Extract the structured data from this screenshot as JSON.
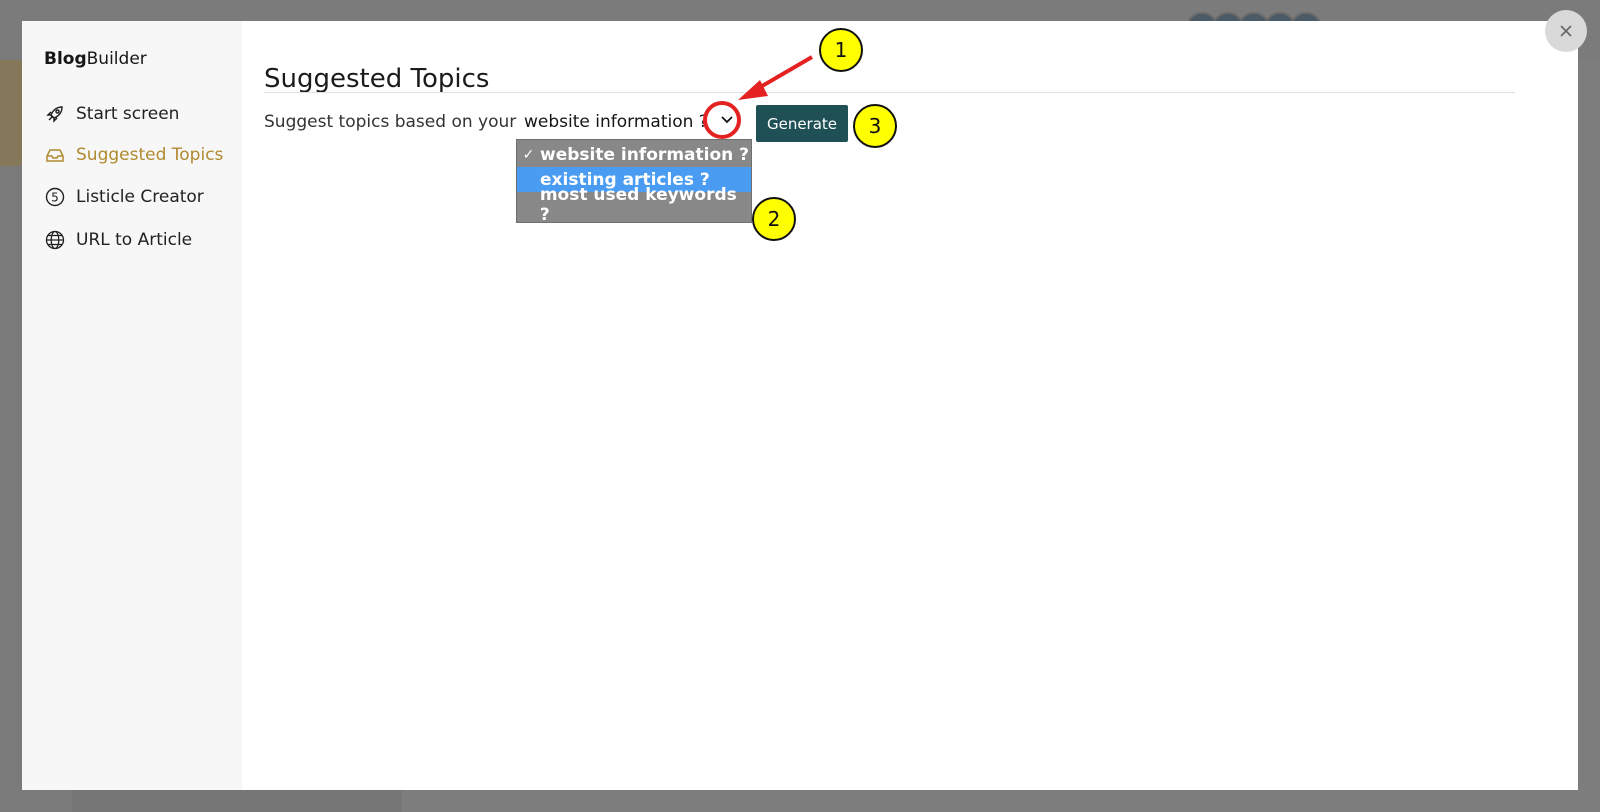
{
  "app": {
    "brand_bold": "Blog",
    "brand_rest": "Builder"
  },
  "sidebar": {
    "items": [
      {
        "label": "Start screen",
        "icon": "rocket-icon",
        "active": false
      },
      {
        "label": "Suggested Topics",
        "icon": "inbox-icon",
        "active": true
      },
      {
        "label": "Listicle Creator",
        "icon": "number-five-icon",
        "active": false
      },
      {
        "label": "URL to Article",
        "icon": "globe-icon",
        "active": false
      }
    ]
  },
  "main": {
    "title": "Suggested Topics",
    "prompt": "Suggest topics based on your",
    "select": {
      "value": "website information ?",
      "options": [
        {
          "label": "website information ?",
          "checked": true
        },
        {
          "label": "existing articles ?",
          "highlighted": true
        },
        {
          "label": "most used keywords ?"
        }
      ]
    },
    "generate_label": "Generate"
  },
  "annotations": {
    "callouts": [
      "1",
      "2",
      "3"
    ],
    "highlight_color": "#e52222",
    "callout_color": "#ffff00"
  },
  "colors": {
    "accent": "#b08a2e",
    "button": "#1f5055",
    "option_highlight": "#4a9cf2"
  }
}
